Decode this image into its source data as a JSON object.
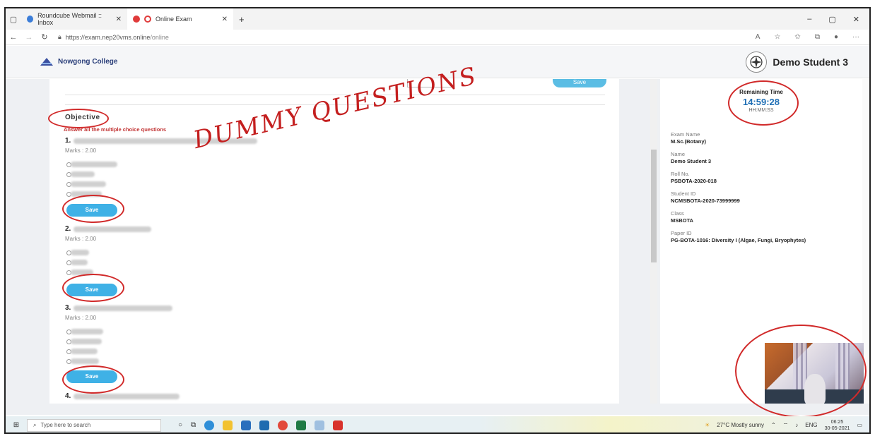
{
  "browser": {
    "tabs": [
      {
        "label": "Roundcube Webmail :: Inbox",
        "active": false
      },
      {
        "label": "Online Exam",
        "active": true
      }
    ],
    "new_tab": "+",
    "url_prefix": "https://exam.nep20vms.online",
    "url_path": "/online",
    "window_controls": [
      "–",
      "▢",
      "✕"
    ]
  },
  "app": {
    "college_name": "Nowgong College",
    "student_name": "Demo Student 3"
  },
  "exam": {
    "section_title": "Objective",
    "instruction": "Answer all the multiple choice questions",
    "questions": [
      {
        "number": "1.",
        "marks": "Marks : 2.00",
        "save_label": "Save"
      },
      {
        "number": "2.",
        "marks": "Marks : 2.00",
        "save_label": "Save"
      },
      {
        "number": "3.",
        "marks": "Marks : 2.00",
        "save_label": "Save"
      },
      {
        "number": "4.",
        "marks": "",
        "save_label": ""
      }
    ],
    "top_save_label": "Save"
  },
  "sidebar": {
    "timer_label": "Remaining Time",
    "timer_value": "14:59:28",
    "timer_format": "HH:MM:SS",
    "fields": [
      {
        "label": "Exam Name",
        "value": "M.Sc.(Botany)"
      },
      {
        "label": "Name",
        "value": "Demo Student 3"
      },
      {
        "label": "Roll No.",
        "value": "PSBOTA-2020-018"
      },
      {
        "label": "Student ID",
        "value": "NCMSBOTA-2020-73999999"
      },
      {
        "label": "Class",
        "value": "MSBOTA"
      },
      {
        "label": "Paper ID",
        "value": "PG-BOTA-1016: Diversity I (Algae, Fungi, Bryophytes)"
      }
    ]
  },
  "annotation": {
    "handwritten_text": "DUMMY QUESTIONS",
    "color": "#d12a2a"
  },
  "taskbar": {
    "search_placeholder": "Type here to search",
    "weather": "27°C  Mostly sunny",
    "language": "ENG",
    "time": "06:25",
    "date": "30-05-2021"
  }
}
